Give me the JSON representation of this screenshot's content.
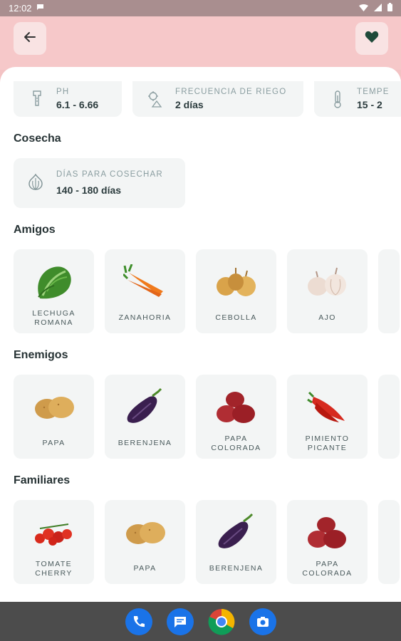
{
  "statusbar": {
    "time": "12:02"
  },
  "info": [
    {
      "label": "PH",
      "value": "6.1 - 6.66",
      "icon": "ph-probe-icon"
    },
    {
      "label": "Frecuencia de riego",
      "value": "2 días",
      "icon": "watering-icon"
    },
    {
      "label": "Tempe",
      "value": "15 - 2",
      "icon": "thermometer-icon"
    }
  ],
  "sections": {
    "harvest_title": "Cosecha",
    "friends_title": "Amigos",
    "enemies_title": "Enemigos",
    "family_title": "Familiares"
  },
  "harvest": {
    "label": "Días para cosechar",
    "value": "140 - 180 días",
    "icon": "garlic-outline-icon"
  },
  "friends": [
    {
      "name": "LECHUGA ROMANA",
      "icon": "lettuce-icon"
    },
    {
      "name": "ZANAHORIA",
      "icon": "carrot-icon"
    },
    {
      "name": "CEBOLLA",
      "icon": "onion-icon"
    },
    {
      "name": "AJO",
      "icon": "garlic-icon"
    }
  ],
  "enemies": [
    {
      "name": "PAPA",
      "icon": "potato-icon"
    },
    {
      "name": "BERENJENA",
      "icon": "eggplant-icon"
    },
    {
      "name": "PAPA COLORADA",
      "icon": "red-potato-icon"
    },
    {
      "name": "PIMIENTO PICANTE",
      "icon": "chili-pepper-icon"
    }
  ],
  "family": [
    {
      "name": "TOMATE CHERRY",
      "icon": "cherry-tomato-icon"
    },
    {
      "name": "PAPA",
      "icon": "potato-icon"
    },
    {
      "name": "BERENJENA",
      "icon": "eggplant-icon"
    },
    {
      "name": "PAPA COLORADA",
      "icon": "red-potato-icon"
    }
  ],
  "colors": {
    "appbar": "#f6c8c9",
    "accent": "#1f4a3a",
    "card": "#f3f5f5"
  }
}
